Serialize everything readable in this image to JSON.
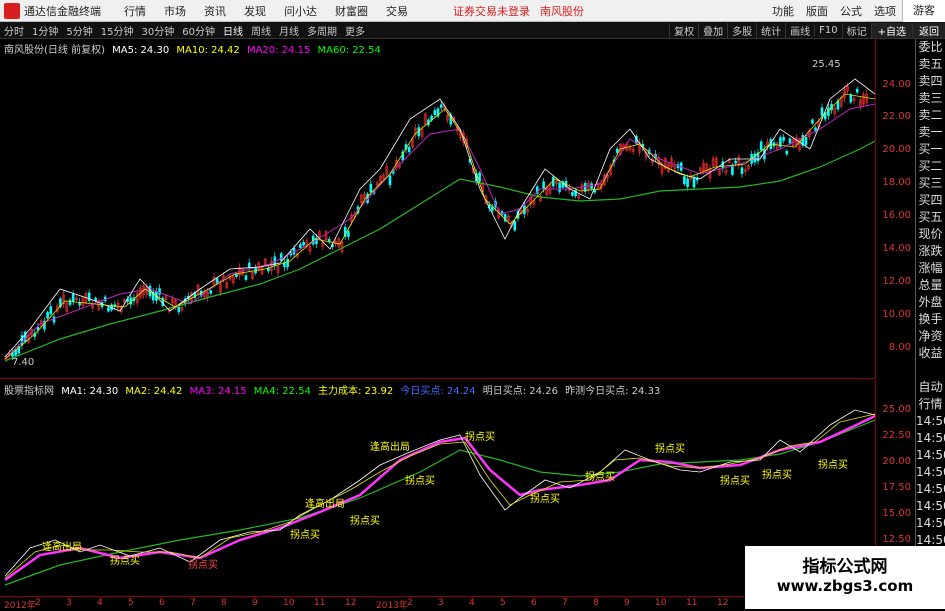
{
  "titlebar": {
    "app_name": "通达信金融终端",
    "menus": [
      "行情",
      "市场",
      "资讯",
      "发现",
      "问小达",
      "财富圈",
      "交易"
    ],
    "status_login": "证券交易未登录",
    "status_stock": "南风股份",
    "right_items": [
      "功能",
      "版面",
      "公式",
      "选项"
    ],
    "guest": "游客"
  },
  "toolbar": {
    "periods": [
      "分时",
      "1分钟",
      "5分钟",
      "15分钟",
      "30分钟",
      "60分钟",
      "日线",
      "周线",
      "月线",
      "多周期",
      "更多"
    ],
    "active_period": "日线",
    "tools": [
      "复权",
      "叠加",
      "多股",
      "统计",
      "画线",
      "F10",
      "标记",
      "+自选",
      "返回"
    ]
  },
  "main_legend": {
    "stock": "南风股份(日线 前复权)",
    "ma5": "MA5: 24.30",
    "ma10": "MA10: 24.42",
    "ma20": "MA20: 24.15",
    "ma60": "MA60: 22.54"
  },
  "main_axis": [
    "24.00",
    "22.00",
    "20.00",
    "18.00",
    "16.00",
    "14.00",
    "12.00",
    "10.00",
    "8.00"
  ],
  "main_labels": {
    "high": "25.45",
    "low": "7.40"
  },
  "sub_legend": {
    "name": "股票指标网",
    "ma1": "MA1: 24.30",
    "ma2": "MA2: 24.42",
    "ma3": "MA3: 24.15",
    "ma4": "MA4: 22.54",
    "cost": "主力成本: 23.92",
    "today": "今日买点: 24.24",
    "tomorrow": "明日买点: 24.26",
    "yesterday": "昨测今日买点: 24.33"
  },
  "sub_axis": [
    "25.00",
    "22.50",
    "20.00",
    "17.50",
    "15.00",
    "12.50"
  ],
  "side_panel": [
    "委比",
    "卖五",
    "卖四",
    "卖三",
    "卖二",
    "卖一",
    "买一",
    "买二",
    "买三",
    "买四",
    "买五",
    "现价",
    "涨跌",
    "涨幅",
    "总量",
    "外盘",
    "换手",
    "净资",
    "收益",
    "",
    "自动",
    "行情",
    "14:50",
    "14:50",
    "14:50",
    "14:50",
    "14:50",
    "14:50",
    "14:50",
    "14:50"
  ],
  "bottom_axis": [
    "2012年",
    "2",
    "3",
    "4",
    "5",
    "6",
    "7",
    "8",
    "9",
    "10",
    "11",
    "12",
    "2013年",
    "2",
    "3",
    "4",
    "5",
    "6",
    "7",
    "8",
    "9",
    "10",
    "11",
    "12"
  ],
  "signals": {
    "buy_points": [
      "拐点买",
      "拐点买",
      "拐点买",
      "拐点买",
      "拐点买",
      "拐点买",
      "拐点买",
      "拐点买",
      "拐点买",
      "拐点买",
      "拐点买",
      "拐点买"
    ],
    "tops": [
      "逢高出局",
      "逢高出局",
      "逢高出局"
    ]
  },
  "watermark": {
    "line1": "指标公式网",
    "line2": "www.zbgs3.com"
  },
  "colors": {
    "ma5": "#ffffff",
    "ma10": "#ffff00",
    "ma20": "#ff00ff",
    "ma60": "#00ff00",
    "up": "#ff3030",
    "down": "#00ffff"
  }
}
